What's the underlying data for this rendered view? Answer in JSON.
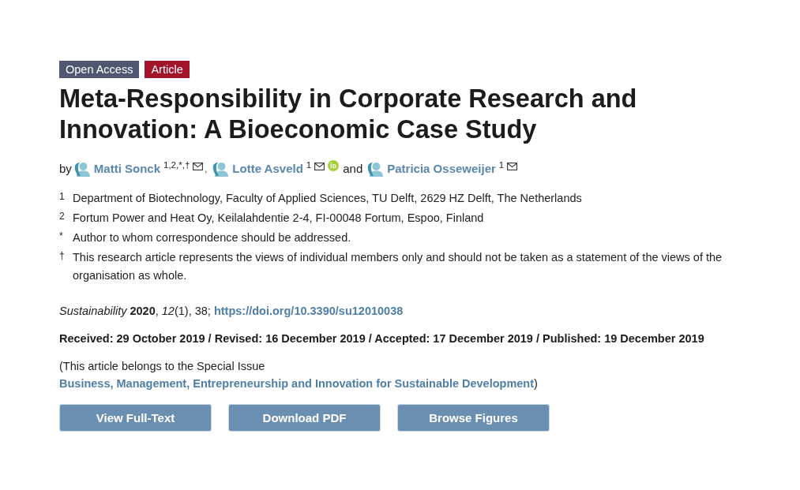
{
  "badges": [
    {
      "kind": "access",
      "label": "Open Access"
    },
    {
      "kind": "type",
      "label": "Article"
    }
  ],
  "title": "Meta-Responsibility in Corporate Research and Innovation: A Bioeconomic Case Study",
  "byline": {
    "prefix": "by",
    "authors": [
      {
        "name": "Matti Sonck",
        "affiliations": "1,2,*,†",
        "email": true,
        "separator": ","
      },
      {
        "name": "Lotte Asveld",
        "affiliations": "1",
        "email": true,
        "orcid": true,
        "separator": "and"
      },
      {
        "name": "Patricia Osseweijer",
        "affiliations": "1",
        "email": true
      }
    ]
  },
  "affiliations": [
    {
      "mark": "1",
      "text": "Department of Biotechnology, Faculty of Applied Sciences, TU Delft, 2629 HZ Delft, The Netherlands"
    },
    {
      "mark": "2",
      "text": "Fortum Power and Heat Oy, Keilalahdentie 2-4, FI-00048 Fortum, Espoo, Finland"
    },
    {
      "mark": "*",
      "text": "Author to whom correspondence should be addressed."
    },
    {
      "mark": "†",
      "text": "This research article represents the views of individual members only and should not be taken as a statement of the views of the organisation as whole."
    }
  ],
  "citation": {
    "text": "*Sustainability* **2020**, *12*(1), 38;",
    "doi_link": "https://doi.org/10.3390/su12010038"
  },
  "dates": "Received: 29 October 2019 / Revised: 16 December 2019 / Accepted: 17 December 2019 / Published: 19 December 2019",
  "special_issue": {
    "prefix": "(This article belongs to the Special Issue",
    "link": "Business, Management, Entrepreneurship and Innovation for Sustainable Development",
    "suffix": ")"
  },
  "buttons": [
    "View Full-Text",
    "Download PDF",
    "Browse Figures"
  ]
}
